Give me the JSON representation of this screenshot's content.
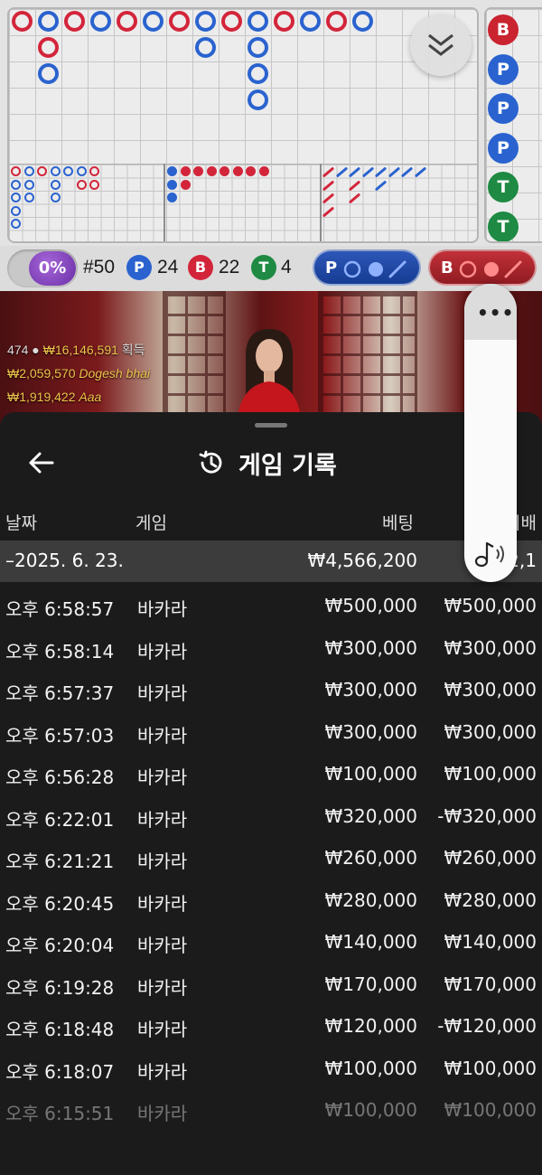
{
  "roadmap": {
    "colors": {
      "player": "#2a63cf",
      "banker": "#d3253a",
      "tie": "#1e8a43"
    },
    "bead_road_visible": [
      "B",
      "P",
      "P",
      "P",
      "T",
      "T"
    ]
  },
  "stats": {
    "percent": "0%",
    "round": "#50",
    "player_letter": "P",
    "player_count": "24",
    "banker_letter": "B",
    "banker_count": "22",
    "tie_letter": "T",
    "tie_count": "4",
    "predict_player_label": "P",
    "predict_banker_label": "B"
  },
  "live": {
    "players_count": "474",
    "total_win": "₩16,146,591",
    "win_suffix": "획득",
    "winners": [
      {
        "amount": "₩2,059,570",
        "name": "Dogesh bhai"
      },
      {
        "amount": "₩1,919,422",
        "name": "Aaa"
      }
    ]
  },
  "history": {
    "title": "게임 기록",
    "columns": {
      "date": "날짜",
      "game": "게임",
      "bet": "베팅",
      "payout": "지배"
    },
    "date_group": {
      "date": "–2025. 6. 23.",
      "bet": "₩4,566,200",
      "payout": "₩2,1"
    },
    "rows": [
      {
        "time": "오후 6:58:57",
        "game": "바카라",
        "bet": "₩500,000",
        "payout": "₩500,000"
      },
      {
        "time": "오후 6:58:14",
        "game": "바카라",
        "bet": "₩300,000",
        "payout": "₩300,000"
      },
      {
        "time": "오후 6:57:37",
        "game": "바카라",
        "bet": "₩300,000",
        "payout": "₩300,000"
      },
      {
        "time": "오후 6:57:03",
        "game": "바카라",
        "bet": "₩300,000",
        "payout": "₩300,000"
      },
      {
        "time": "오후 6:56:28",
        "game": "바카라",
        "bet": "₩100,000",
        "payout": "₩100,000"
      },
      {
        "time": "오후 6:22:01",
        "game": "바카라",
        "bet": "₩320,000",
        "payout": "-₩320,000"
      },
      {
        "time": "오후 6:21:21",
        "game": "바카라",
        "bet": "₩260,000",
        "payout": "₩260,000"
      },
      {
        "time": "오후 6:20:45",
        "game": "바카라",
        "bet": "₩280,000",
        "payout": "₩280,000"
      },
      {
        "time": "오후 6:20:04",
        "game": "바카라",
        "bet": "₩140,000",
        "payout": "₩140,000"
      },
      {
        "time": "오후 6:19:28",
        "game": "바카라",
        "bet": "₩170,000",
        "payout": "₩170,000"
      },
      {
        "time": "오후 6:18:48",
        "game": "바카라",
        "bet": "₩120,000",
        "payout": "-₩120,000"
      },
      {
        "time": "오후 6:18:07",
        "game": "바카라",
        "bet": "₩100,000",
        "payout": "₩100,000"
      },
      {
        "time": "오후 6:15:51",
        "game": "바카라",
        "bet": "₩100,000",
        "payout": "₩100,000"
      }
    ]
  },
  "menu": {
    "more_label": "•••"
  }
}
